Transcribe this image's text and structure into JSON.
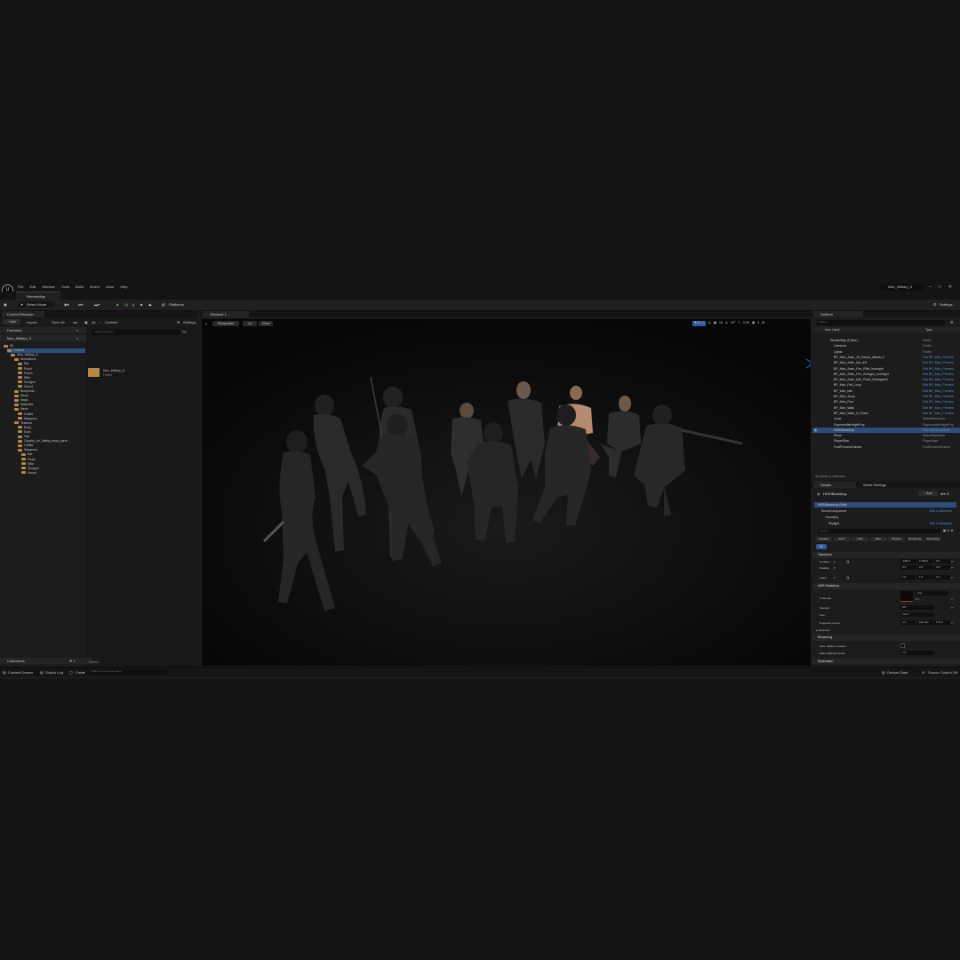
{
  "menu": {
    "items": [
      "File",
      "Edit",
      "Window",
      "Tools",
      "Build",
      "Select",
      "Actor",
      "Help"
    ],
    "project": "Man_Military_5"
  },
  "map_tab": "RenderMap",
  "toolbar": {
    "select_mode": "Select Mode",
    "platforms": "Platforms",
    "settings": "Settings"
  },
  "content_browser": {
    "tab": "Content Browser",
    "add": "Add",
    "import": "Import",
    "save_all": "Save All",
    "path": [
      "All",
      "Content"
    ],
    "settings": "Settings",
    "search_placeholder": "Search Content",
    "favorites": "Favorites",
    "project": "Man_Military_5",
    "tree": [
      {
        "label": "All",
        "depth": 0
      },
      {
        "label": "Content",
        "depth": 1
      },
      {
        "label": "Man_Military_5",
        "depth": 2
      },
      {
        "label": "Animations",
        "depth": 3
      },
      {
        "label": "Bat",
        "depth": 4
      },
      {
        "label": "Pistol",
        "depth": 4
      },
      {
        "label": "Poses",
        "depth": 4
      },
      {
        "label": "Rifle",
        "depth": 4
      },
      {
        "label": "Shotgun",
        "depth": 4
      },
      {
        "label": "Sword",
        "depth": 4
      },
      {
        "label": "Blueprints",
        "depth": 3
      },
      {
        "label": "Demo",
        "depth": 3
      },
      {
        "label": "Maps",
        "depth": 3
      },
      {
        "label": "Materials",
        "depth": 3
      },
      {
        "label": "Mesh",
        "depth": 3
      },
      {
        "label": "Outfits",
        "depth": 4
      },
      {
        "label": "Weapons",
        "depth": 4
      },
      {
        "label": "Textures",
        "depth": 3
      },
      {
        "label": "Body",
        "depth": 4
      },
      {
        "label": "Eyes",
        "depth": 4
      },
      {
        "label": "Hair",
        "depth": 4
      },
      {
        "label": "Opacity_for_hiding_body_parts",
        "depth": 4
      },
      {
        "label": "Outfits",
        "depth": 4
      },
      {
        "label": "Weapons",
        "depth": 4
      },
      {
        "label": "Bat",
        "depth": 5
      },
      {
        "label": "Pistol",
        "depth": 5
      },
      {
        "label": "Rifle",
        "depth": 5
      },
      {
        "label": "Shotgun",
        "depth": 5
      },
      {
        "label": "Sword",
        "depth": 5
      }
    ],
    "asset_name": "Man_Military_5",
    "asset_type": "Folder",
    "collections": "Collections",
    "item_count": "1 item"
  },
  "viewport": {
    "tab": "Viewport 1",
    "perspective": "Perspective",
    "lit": "Lit",
    "show": "Show",
    "values": [
      "10",
      "10°",
      "0.25",
      "4"
    ]
  },
  "outliner": {
    "tab": "Outliner",
    "search_placeholder": "Search...",
    "col_label": "Item Label",
    "col_type": "Type",
    "rows": [
      {
        "label": "RenderMap (Editor)",
        "type": "World",
        "link": false,
        "depth": 1
      },
      {
        "label": "Cameras",
        "type": "Folder",
        "link": false,
        "depth": 2
      },
      {
        "label": "Lights",
        "type": "Folder",
        "link": false,
        "depth": 2
      },
      {
        "label": "BP_Man_Anim_15_Sword_Attack_4",
        "type": "Edit BP_Man_Preview",
        "link": true,
        "depth": 2
      },
      {
        "label": "BP_Man_Anim_bat_left",
        "type": "Edit BP_Man_Preview",
        "link": true,
        "depth": 2
      },
      {
        "label": "BP_Man_Anim_Fire_Rifle_Ironsight",
        "type": "Edit BP_Man_Preview",
        "link": true,
        "depth": 2
      },
      {
        "label": "BP_Man_Anim_Fire_Shotgun_Ironsight",
        "type": "Edit BP_Man_Preview",
        "link": true,
        "depth": 2
      },
      {
        "label": "BP_Man_Anim_Idle_Pistol_Retargeted",
        "type": "Edit BP_Man_Preview",
        "link": true,
        "depth": 2
      },
      {
        "label": "BP_Man_Fall_Loop",
        "type": "Edit BP_Man_Preview",
        "link": true,
        "depth": 2
      },
      {
        "label": "BP_Man_Idle",
        "type": "Edit BP_Man_Preview",
        "link": true,
        "depth": 2
      },
      {
        "label": "BP_Man_Jump",
        "type": "Edit BP_Man_Preview",
        "link": true,
        "depth": 2
      },
      {
        "label": "BP_Man_Run",
        "type": "Edit BP_Man_Preview",
        "link": true,
        "depth": 2
      },
      {
        "label": "BP_Man_Walk",
        "type": "Edit BP_Man_Preview",
        "link": true,
        "depth": 2
      },
      {
        "label": "BP_Man_Walk_In_Place",
        "type": "Edit BP_Man_Preview",
        "link": true,
        "depth": 2
      },
      {
        "label": "Cube",
        "type": "StaticMeshActor",
        "link": false,
        "depth": 2
      },
      {
        "label": "ExponentialHeightFog",
        "type": "ExponentialHeightFog",
        "link": false,
        "depth": 2
      },
      {
        "label": "HDRIBackdrop",
        "type": "Edit HDRIBackdrop",
        "link": true,
        "depth": 2,
        "selected": true
      },
      {
        "label": "Plane",
        "type": "StaticMeshActor",
        "link": false,
        "depth": 2
      },
      {
        "label": "PlayerStart",
        "type": "PlayerStart",
        "link": false,
        "depth": 2
      },
      {
        "label": "PostProcessVolume",
        "type": "PostProcessVolume",
        "link": false,
        "depth": 2
      }
    ],
    "footer": "48 actors (1 selected)"
  },
  "details": {
    "tab": "Details",
    "tab2": "World Settings",
    "actor": "HDRIBackdrop",
    "add": "Add",
    "components": [
      {
        "label": "HDRIBackdrop (Self)",
        "link": ""
      },
      {
        "label": "SceneComponent",
        "link": "Edit in Blueprint"
      },
      {
        "label": "Geometry",
        "link": ""
      },
      {
        "label": "Skylight",
        "link": "Edit in Blueprint"
      }
    ],
    "search_placeholder": "Search",
    "filters": [
      "General",
      "Actor",
      "LOD",
      "Misc",
      "Physics",
      "Rendering",
      "Streaming"
    ],
    "all": "All",
    "transform": "Transform",
    "location_label": "Location",
    "location": [
      "-188.0",
      "2 180.0",
      "0.0"
    ],
    "rotation_label": "Rotation",
    "rotation": [
      "0.0 °",
      "0.0 °",
      "0.0 °"
    ],
    "scale_label": "Scale",
    "scale": [
      "1.0",
      "1.0",
      "1.0"
    ],
    "hdri_section": "HDRI Backdrop",
    "cubemap_label": "Cubemap",
    "cubemap_value": "Any",
    "intensity_label": "Intensity",
    "intensity": "0.8",
    "size_label": "Size",
    "size": "700.0",
    "projection_label": "Projection Center",
    "projection": [
      "0.0",
      "182.241",
      "170.0"
    ],
    "advanced": "Advanced",
    "rendering_section": "Rendering",
    "hidden_label": "Actor Hidden In Game",
    "billboard_label": "Editor Billboard Scale",
    "billboard": "1.0",
    "replication": "Replication"
  },
  "statusbar": {
    "content_drawer": "Content Drawer",
    "output_log": "Output Log",
    "cmd": "Cmd",
    "cmd_placeholder": "Enter Console Command",
    "derived_data": "Derived Data",
    "source_control": "Source Control Off"
  }
}
